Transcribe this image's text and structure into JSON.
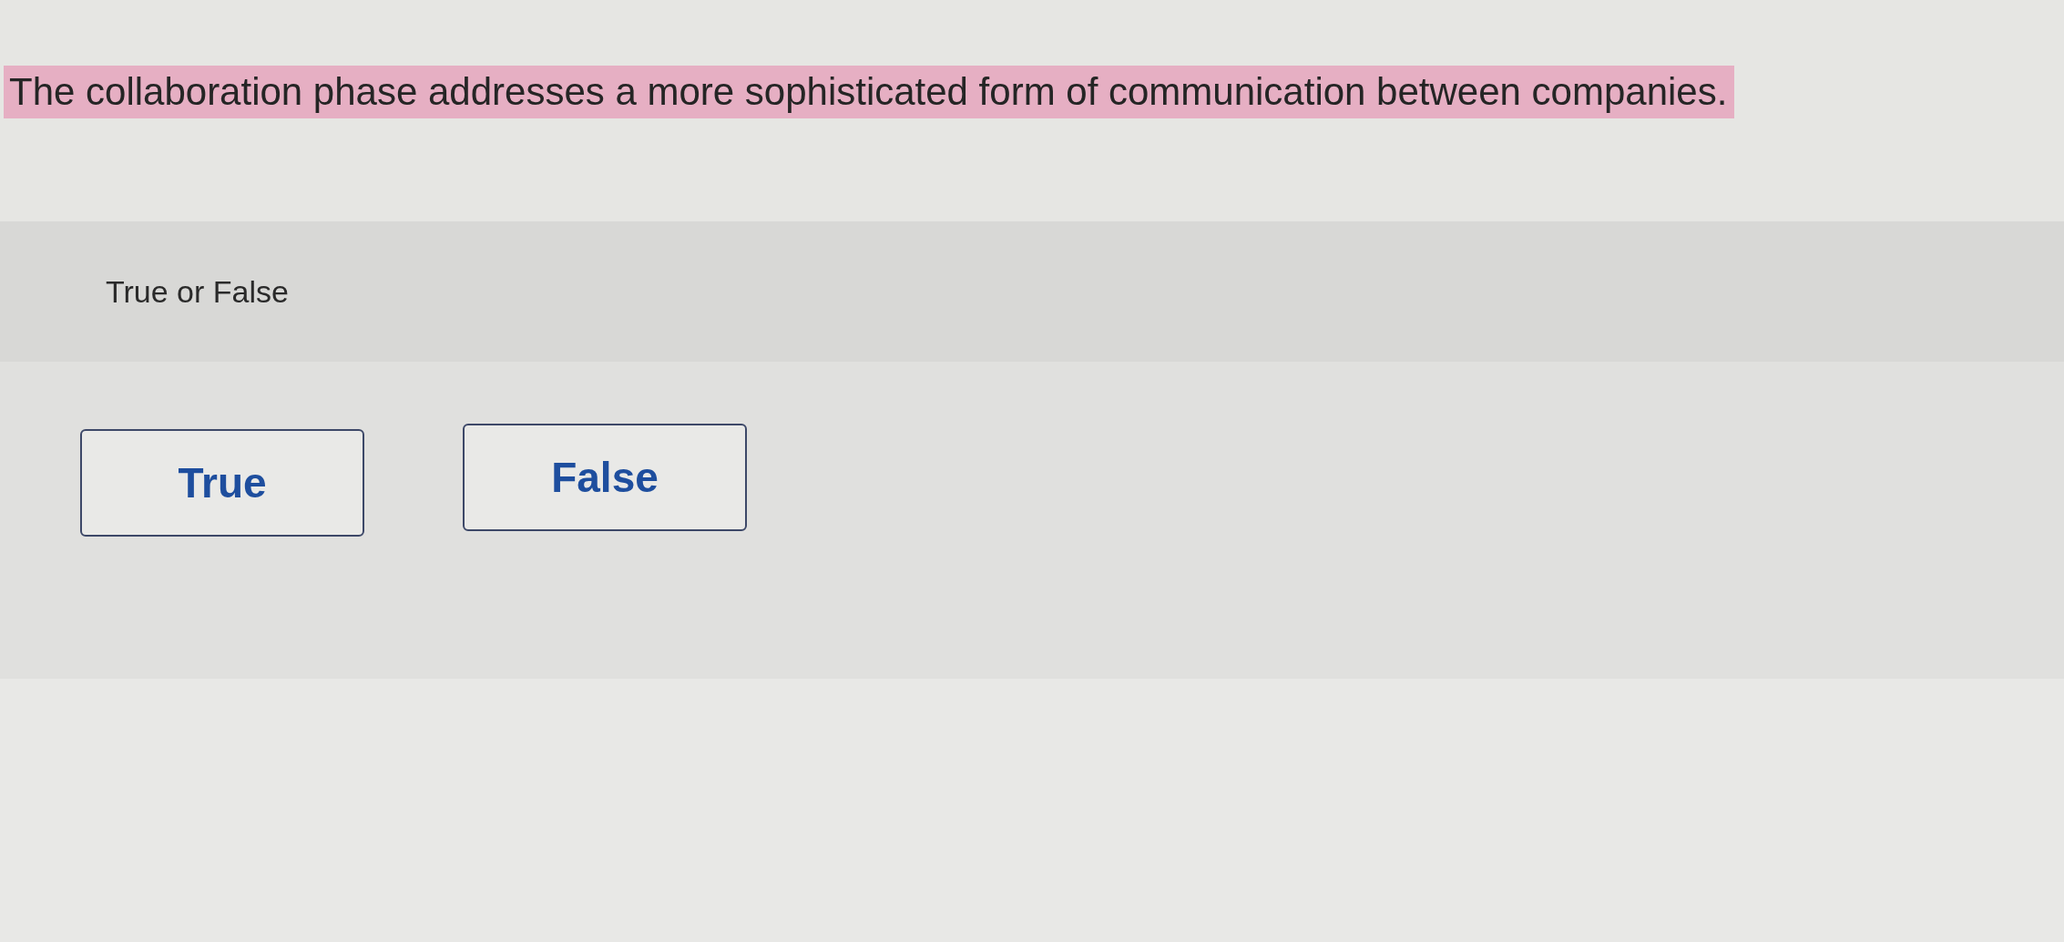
{
  "question": {
    "text": "The collaboration phase addresses a more sophisticated form of communication between companies.",
    "highlighted": true
  },
  "prompt": "True or False",
  "options": [
    {
      "label": "True",
      "selected": false
    },
    {
      "label": "False",
      "selected": false
    }
  ]
}
